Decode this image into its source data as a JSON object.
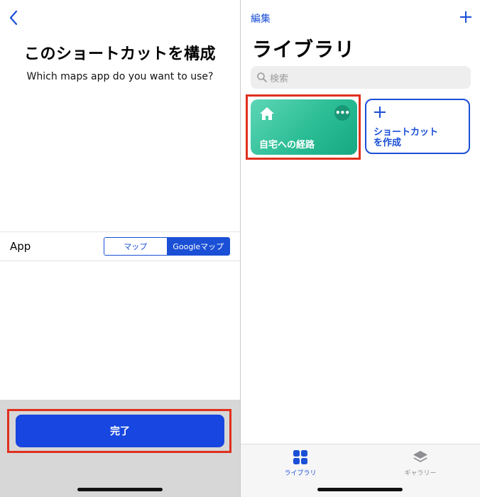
{
  "left": {
    "header": {
      "back_icon": "chevron-left-icon"
    },
    "title": "このショートカットを構成",
    "subtitle": "Which maps app do you want to use?",
    "app_row": {
      "label": "App",
      "segments": [
        "マップ",
        "Googleマップ"
      ],
      "selected": "Googleマップ"
    },
    "done_button": "完了"
  },
  "right": {
    "header": {
      "edit": "編集",
      "add_icon": "plus-icon"
    },
    "title": "ライブラリ",
    "search": {
      "placeholder": "検索",
      "icon": "magnifier-icon"
    },
    "shortcuts": [
      {
        "name": "自宅への経路",
        "icon": "house-icon",
        "more_icon": "ellipsis-icon"
      }
    ],
    "create_tile": {
      "label": "ショートカット\nを作成",
      "icon": "plus-icon"
    },
    "tabbar": [
      {
        "label": "ライブラリ",
        "icon": "grid-icon",
        "active": true
      },
      {
        "label": "ギャラリー",
        "icon": "stack-icon",
        "active": false
      }
    ]
  },
  "colors": {
    "accent": "#1a4fd6",
    "done_button": "#1746e0",
    "highlight": "#e0301e",
    "tile_gradient_start": "#5dd6b6",
    "tile_gradient_end": "#16a882",
    "bottom_panel": "#d7d7d7"
  }
}
